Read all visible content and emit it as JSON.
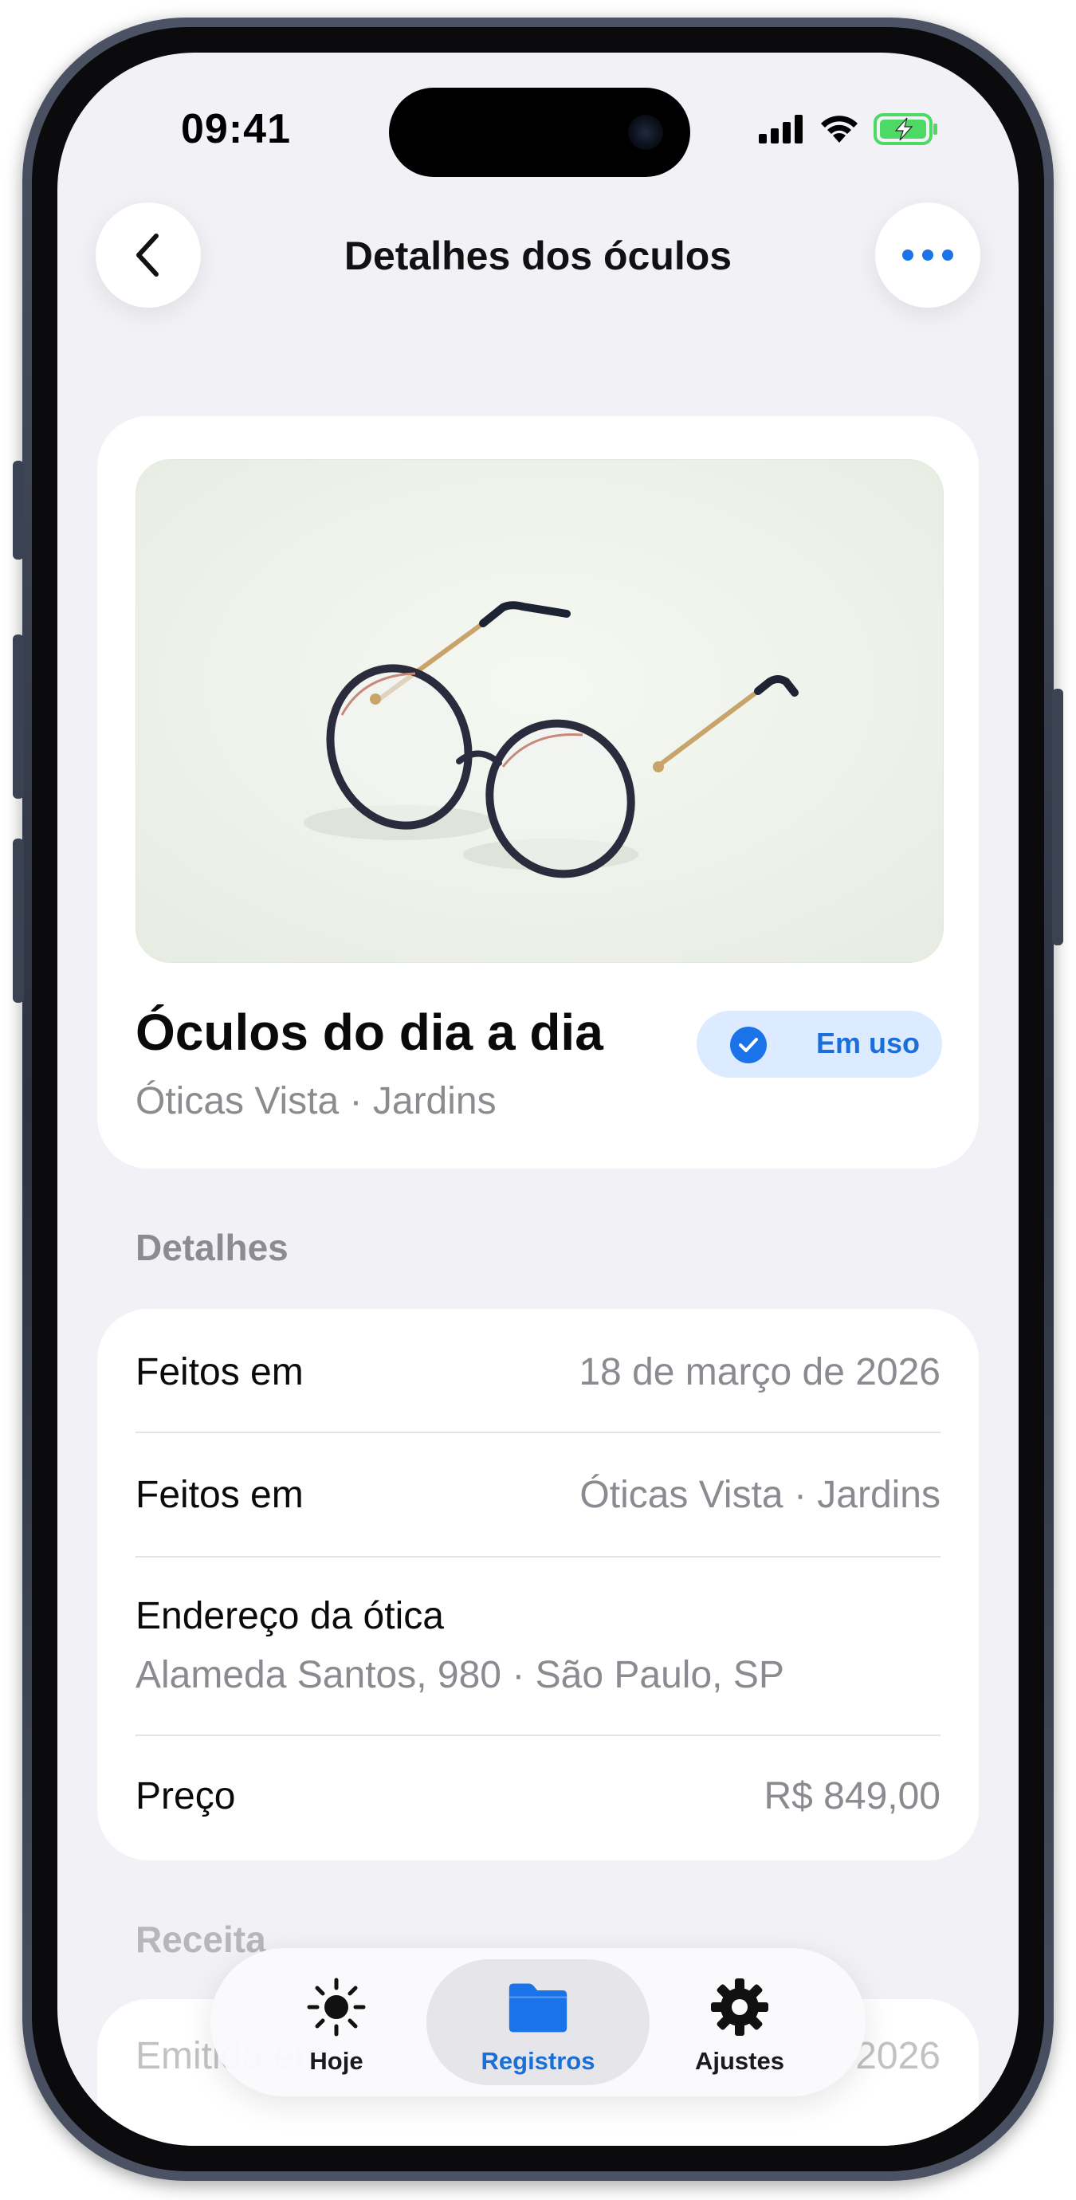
{
  "status_bar": {
    "time": "09:41",
    "icons": [
      "signal-bars-icon",
      "wifi-icon",
      "battery-charging-icon"
    ],
    "battery_color": "#4cd964"
  },
  "nav": {
    "title": "Detalhes dos óculos",
    "back_icon": "chevron-left-icon",
    "more_icon": "ellipsis-icon"
  },
  "item": {
    "photo": "eyeglasses-photo",
    "title": "Óculos do dia a dia",
    "subtitle": "Óticas Vista · Jardins",
    "status_label": "Em uso",
    "status_icon": "checkmark-circle-icon"
  },
  "details": {
    "header": "Detalhes",
    "rows": [
      {
        "label": "Feitos em",
        "value": "18 de março de 2026"
      },
      {
        "label": "Feitos em",
        "value": "Óticas Vista · Jardins"
      },
      {
        "label": "Endereço da ótica",
        "value": "Alameda Santos, 980 · São Paulo, SP"
      },
      {
        "label": "Preço",
        "value": "R$ 849,00"
      }
    ]
  },
  "receita": {
    "header": "Receita",
    "first_row_label": "Emitida em",
    "first_row_value": "2026"
  },
  "tab_bar": {
    "tabs": [
      {
        "label": "Hoje",
        "icon": "sun-icon",
        "active": false
      },
      {
        "label": "Registros",
        "icon": "folder-icon",
        "active": true
      },
      {
        "label": "Ajustes",
        "icon": "gear-icon",
        "active": false
      }
    ]
  },
  "colors": {
    "accent": "#1a73e8",
    "background": "#f1f1f6",
    "card": "#ffffff",
    "badge_bg": "#dcebff"
  }
}
